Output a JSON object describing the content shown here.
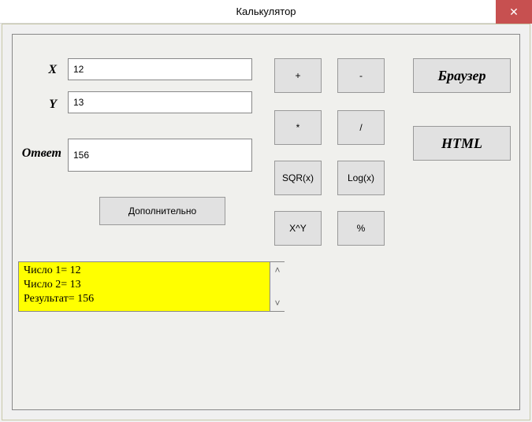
{
  "window": {
    "title": "Калькулятор",
    "close": "✕"
  },
  "labels": {
    "x": "X",
    "y": "Y",
    "answer": "Ответ"
  },
  "inputs": {
    "x": "12",
    "y": "13",
    "answer": "156"
  },
  "ops": {
    "plus": "+",
    "minus": "-",
    "mul": "*",
    "div": "/",
    "sqr": "SQR(x)",
    "log": "Log(x)",
    "pow": "X^Y",
    "pct": "%"
  },
  "extra": {
    "label": "Дополнительно"
  },
  "side": {
    "browser": "Браузер",
    "html": "HTML"
  },
  "log": {
    "lines": [
      "Число 1= 12",
      "Число 2= 13",
      "Результат= 156"
    ]
  }
}
